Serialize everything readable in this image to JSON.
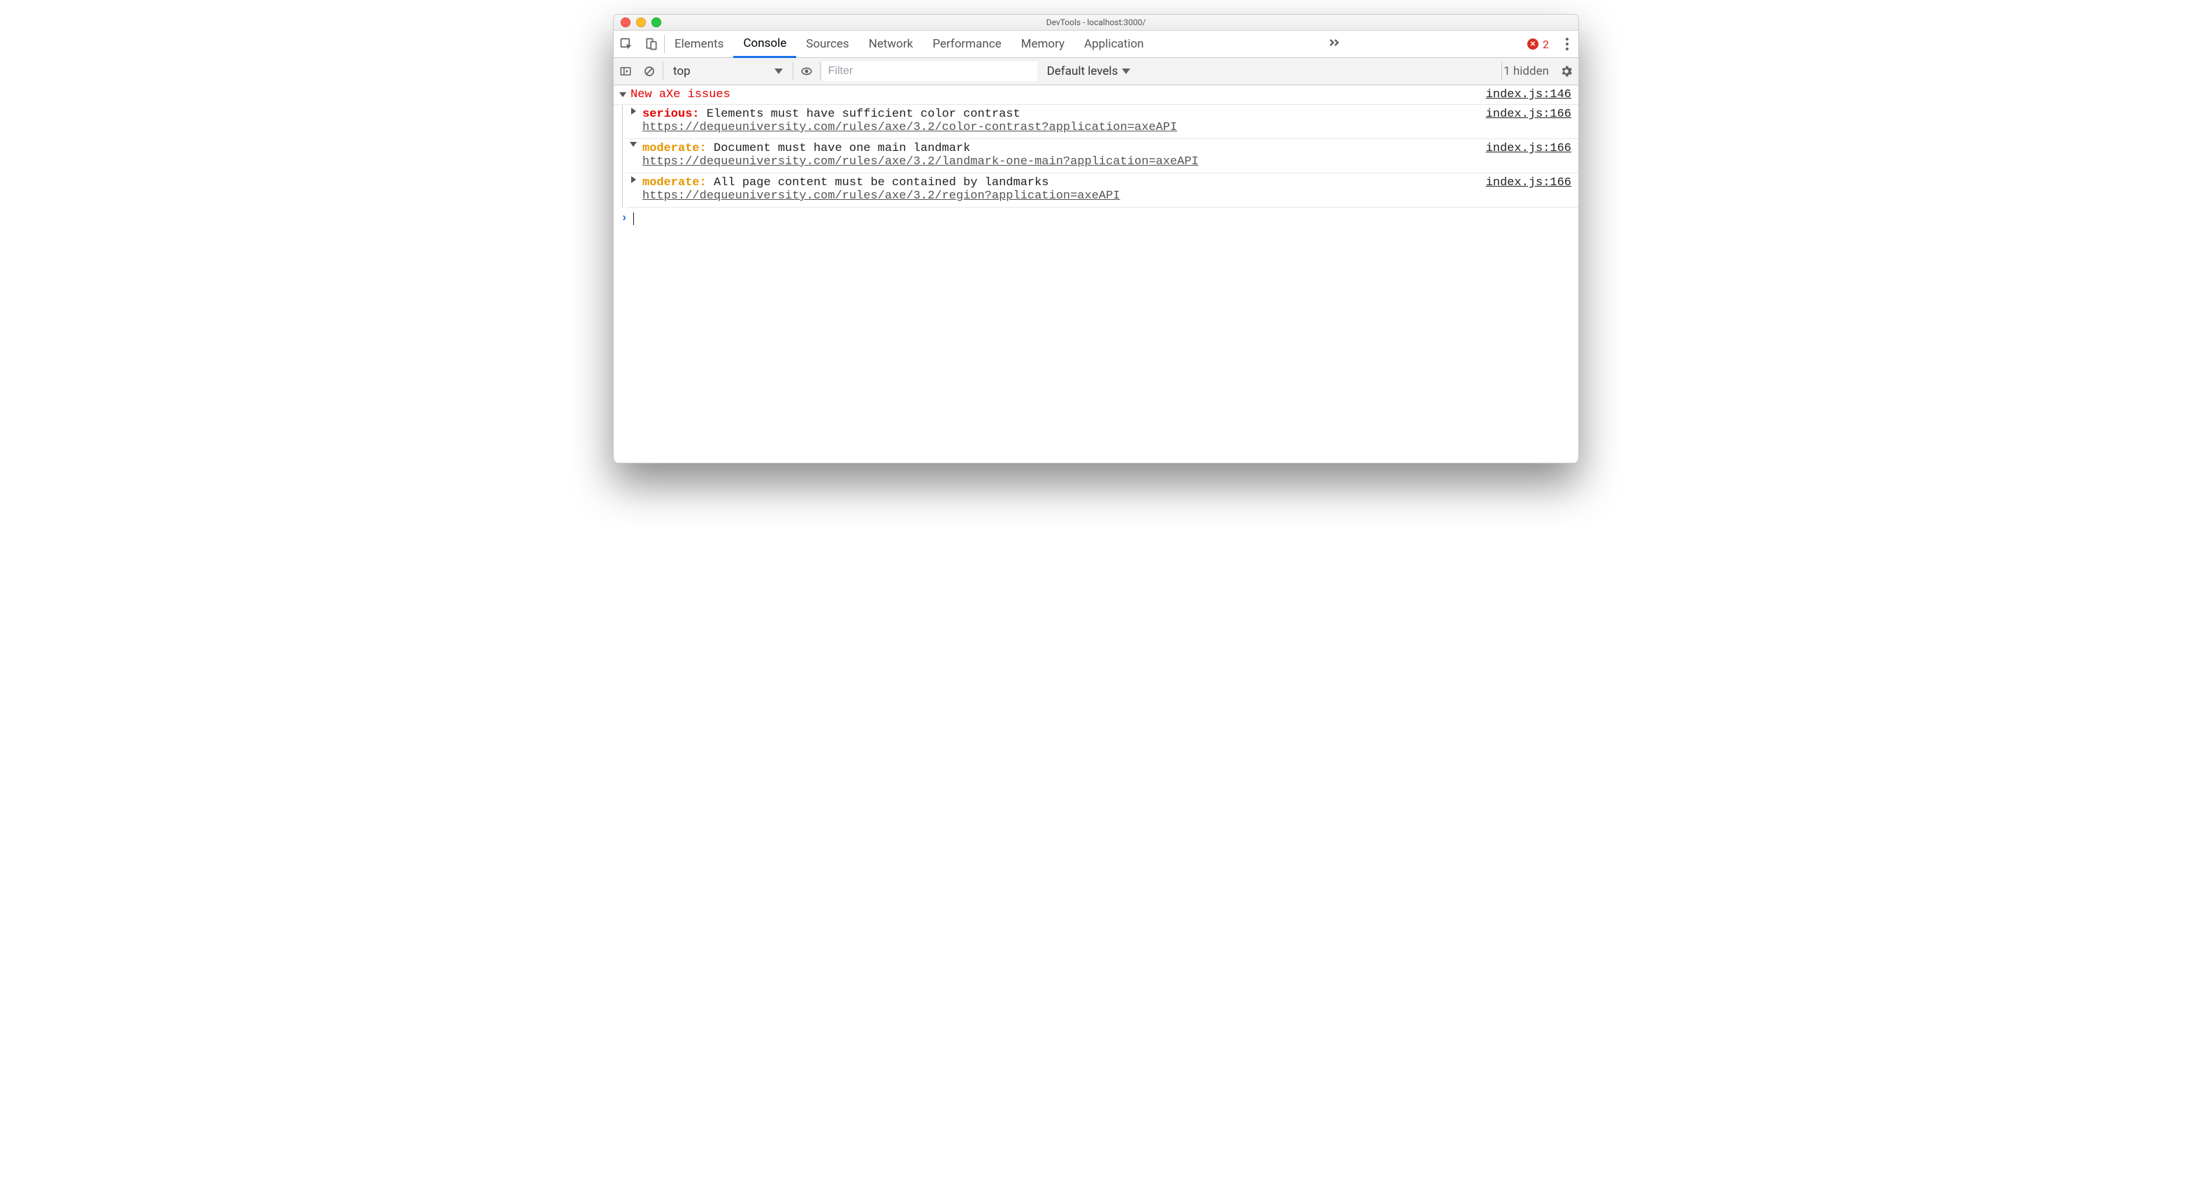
{
  "window": {
    "title": "DevTools - localhost:3000/"
  },
  "tabs": {
    "items": [
      "Elements",
      "Console",
      "Sources",
      "Network",
      "Performance",
      "Memory",
      "Application"
    ],
    "active": "Console",
    "errors_count": "2"
  },
  "toolbar": {
    "context": "top",
    "filter_placeholder": "Filter",
    "levels_label": "Default levels",
    "hidden_label": "1 hidden"
  },
  "console": {
    "group_title": "New aXe issues",
    "group_src": "index.js:146",
    "messages": [
      {
        "open": false,
        "severity": "serious",
        "severity_label": "serious:",
        "text": "Elements must have sufficient color contrast",
        "url": "https://dequeuniversity.com/rules/axe/3.2/color-contrast?application=axeAPI",
        "src": "index.js:166"
      },
      {
        "open": true,
        "severity": "moderate",
        "severity_label": "moderate:",
        "text": "Document must have one main landmark",
        "url": "https://dequeuniversity.com/rules/axe/3.2/landmark-one-main?application=axeAPI",
        "src": "index.js:166"
      },
      {
        "open": false,
        "severity": "moderate",
        "severity_label": "moderate:",
        "text": "All page content must be contained by landmarks",
        "url": "https://dequeuniversity.com/rules/axe/3.2/region?application=axeAPI",
        "src": "index.js:166"
      }
    ]
  }
}
